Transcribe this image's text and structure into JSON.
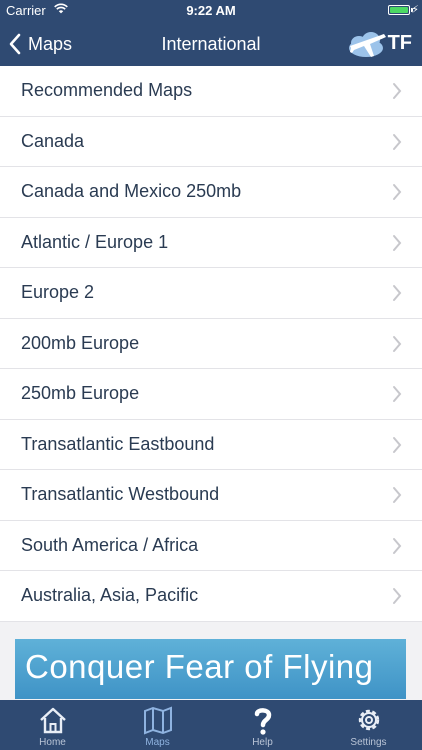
{
  "status_bar": {
    "carrier": "Carrier",
    "time": "9:22 AM"
  },
  "nav": {
    "back_label": "Maps",
    "title": "International",
    "logo_text": "TF"
  },
  "list": {
    "items": [
      {
        "label": "Recommended Maps"
      },
      {
        "label": "Canada"
      },
      {
        "label": "Canada and Mexico 250mb"
      },
      {
        "label": "Atlantic / Europe 1"
      },
      {
        "label": "Europe 2"
      },
      {
        "label": "200mb Europe"
      },
      {
        "label": "250mb Europe"
      },
      {
        "label": "Transatlantic Eastbound"
      },
      {
        "label": "Transatlantic Westbound"
      },
      {
        "label": "South America / Africa"
      },
      {
        "label": "Australia, Asia, Pacific"
      }
    ]
  },
  "banner": {
    "text": "Conquer Fear of Flying"
  },
  "tabbar": {
    "tabs": [
      {
        "label": "Home",
        "icon": "home-icon"
      },
      {
        "label": "Maps",
        "icon": "map-icon",
        "active": true
      },
      {
        "label": "Help",
        "icon": "question-icon"
      },
      {
        "label": "Settings",
        "icon": "gear-icon"
      }
    ]
  },
  "colors": {
    "bar": "#2f4a72",
    "list_text": "#2a3b52",
    "active_tab": "#8fb3e0",
    "battery": "#4cd964"
  }
}
